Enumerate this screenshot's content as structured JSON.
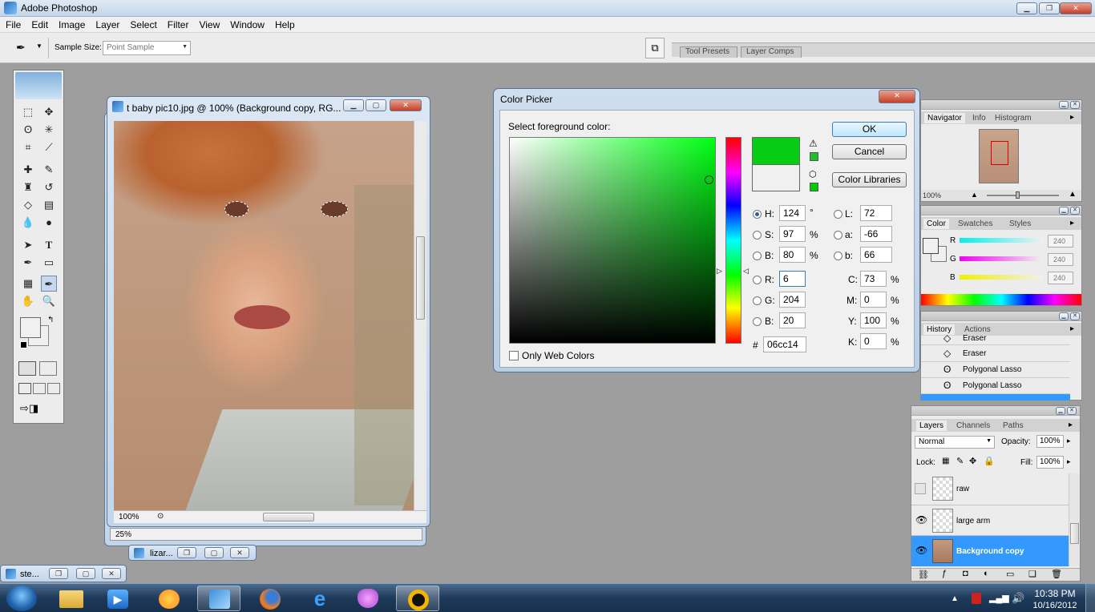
{
  "app": {
    "title": "Adobe Photoshop"
  },
  "menu": [
    "File",
    "Edit",
    "Image",
    "Layer",
    "Select",
    "Filter",
    "View",
    "Window",
    "Help"
  ],
  "options": {
    "sample_size_label": "Sample Size:",
    "sample_size_value": "Point Sample",
    "tool_presets": "Tool Presets",
    "layer_comps": "Layer Comps"
  },
  "document": {
    "title": "t baby pic10.jpg @ 100% (Background copy, RG...",
    "zoom": "100%",
    "back_zoom": "25%"
  },
  "minimized": [
    {
      "label": "lizar..."
    },
    {
      "label": "ste..."
    }
  ],
  "color_picker": {
    "title": "Color Picker",
    "prompt": "Select foreground color:",
    "ok": "OK",
    "cancel": "Cancel",
    "libraries": "Color Libraries",
    "new_color": "#06cc14",
    "old_color": "#f0f0f0",
    "hsb": {
      "h_label": "H:",
      "h": "124",
      "h_unit": "°",
      "s_label": "S:",
      "s": "97",
      "s_unit": "%",
      "b_label": "B:",
      "b": "80",
      "b_unit": "%"
    },
    "rgb": {
      "r_label": "R:",
      "r": "6",
      "g_label": "G:",
      "g": "204",
      "b_label": "B:",
      "b": "20"
    },
    "lab": {
      "l_label": "L:",
      "l": "72",
      "a_label": "a:",
      "a": "-66",
      "b_label": "b:",
      "b": "66"
    },
    "cmyk": {
      "c_label": "C:",
      "c": "73",
      "c_unit": "%",
      "m_label": "M:",
      "m": "0",
      "m_unit": "%",
      "y_label": "Y:",
      "y": "100",
      "y_unit": "%",
      "k_label": "K:",
      "k": "0",
      "k_unit": "%"
    },
    "hex_label": "#",
    "hex": "06cc14",
    "web_only": "Only Web Colors"
  },
  "navigator": {
    "tabs": [
      "Navigator",
      "Info",
      "Histogram"
    ],
    "zoom": "100%"
  },
  "color_panel": {
    "tabs": [
      "Color",
      "Swatches",
      "Styles"
    ],
    "r_label": "R",
    "r": "240",
    "g_label": "G",
    "g": "240",
    "b_label": "B",
    "b": "240"
  },
  "history": {
    "tabs": [
      "History",
      "Actions"
    ],
    "items": [
      "Eraser",
      "Eraser",
      "Polygonal Lasso",
      "Polygonal Lasso"
    ]
  },
  "layers": {
    "tabs": [
      "Layers",
      "Channels",
      "Paths"
    ],
    "blend": "Normal",
    "opacity_label": "Opacity:",
    "opacity": "100%",
    "lock_label": "Lock:",
    "fill_label": "Fill:",
    "fill": "100%",
    "items": [
      {
        "name": "raw"
      },
      {
        "name": "large arm"
      },
      {
        "name": "Background copy"
      }
    ]
  },
  "clock": {
    "time": "10:38 PM",
    "date": "10/16/2012"
  }
}
